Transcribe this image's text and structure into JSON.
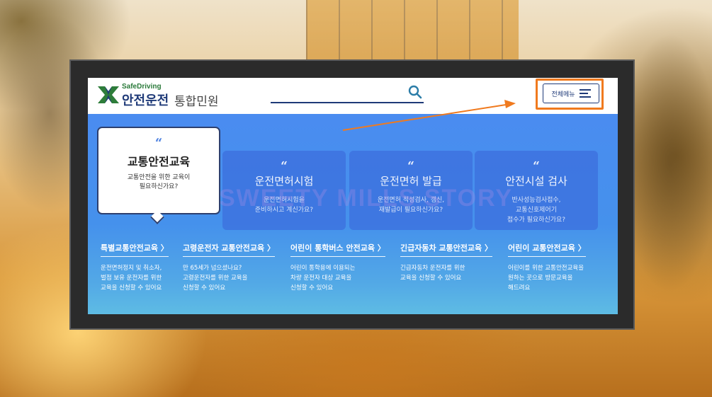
{
  "logo": {
    "sub": "SafeDriving",
    "main": "안전운전",
    "tail": "통합민원"
  },
  "header": {
    "menu_label": "전체메뉴"
  },
  "cards": [
    {
      "quote": "“",
      "title": "교통안전교육",
      "desc": "교통안전을 위한 교육이\n필요하신가요?"
    },
    {
      "quote": "“",
      "title": "운전면허시험",
      "desc": "운전면허시험을\n준비하시고 계신가요?"
    },
    {
      "quote": "“",
      "title": "운전면허 발급",
      "desc": "운전면허 적성검사, 갱신,\n재발급이 필요하신가요?"
    },
    {
      "quote": "“",
      "title": "안전시설 검사",
      "desc": "반사성능검사접수,\n교통신호제어기\n접수가 필요하신가요?"
    }
  ],
  "links": [
    {
      "title": "특별교통안전교육 〉",
      "desc": "운전면허정지 및 취소자,\n벌점 보유 운전자를 위한\n교육을 신청할 수 있어요"
    },
    {
      "title": "고령운전자 교통안전교육 〉",
      "desc": "만 65세가 넘으셨나요?\n고령운전자를 위한 교육을\n신청할 수 있어요"
    },
    {
      "title": "어린이 통학버스 안전교육 〉",
      "desc": "어린이 통학용에 이용되는\n차량 운전자 대상 교육을\n신청할 수 있어요"
    },
    {
      "title": "긴급자동차 교통안전교육 〉",
      "desc": "긴급자동차 운전자를 위한\n교육을 신청할 수 있어요"
    },
    {
      "title": "어린이 교통안전교육 〉",
      "desc": "어린이를 위한 교통안전교육을\n원하는 곳으로 방문교육을\n해드려요"
    }
  ],
  "watermark": "SWEETY MILLS STORY",
  "colors": {
    "accent": "#f07a1e",
    "brand": "#1f3a78",
    "hero": "#4a8cf0"
  }
}
